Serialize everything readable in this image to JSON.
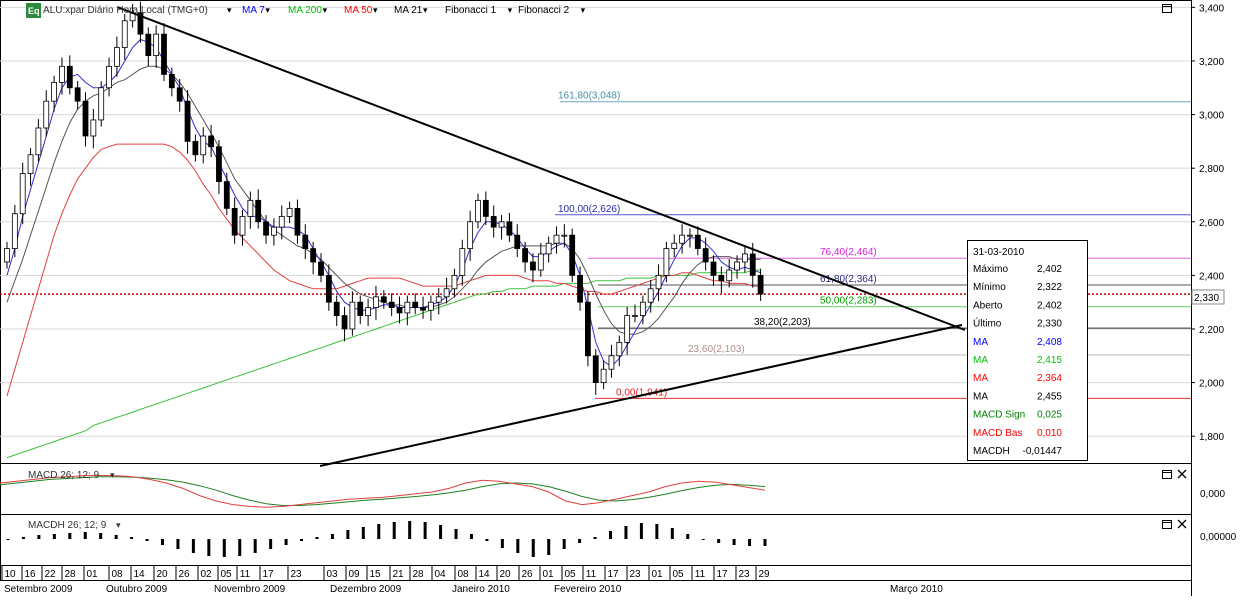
{
  "header": {
    "badge": "Eq",
    "symbol_label": "ALU:xpar Diário Hora Local (TMG+0)",
    "indicators": [
      {
        "label": "MA 7",
        "color": "#0000ff"
      },
      {
        "label": "MA 200",
        "color": "#00c000"
      },
      {
        "label": "MA 50",
        "color": "#ff0000"
      },
      {
        "label": "MA 21",
        "color": "#000000"
      },
      {
        "label": "Fibonacci 1",
        "color": "#000000"
      },
      {
        "label": "Fibonacci 2",
        "color": "#000000"
      }
    ],
    "dropdown_glyph": "▾"
  },
  "price_axis": {
    "ticks": [
      "3,400",
      "3,200",
      "3,000",
      "2,800",
      "2,600",
      "2,400",
      "2,200",
      "2,000",
      "1,800"
    ],
    "current_price": "2,330"
  },
  "macd_panel": {
    "label": "MACD 26; 12; 9",
    "axis_tick": "0,000"
  },
  "macdh_panel": {
    "label": "MACDH 26; 12; 9",
    "axis_tick": "0,00000"
  },
  "date_axis": {
    "days": [
      "10",
      "16",
      "22",
      "28",
      "01",
      "08",
      "14",
      "20",
      "26",
      "02",
      "05",
      "11",
      "17",
      "23",
      "03",
      "09",
      "15",
      "21",
      "28",
      "04",
      "08",
      "14",
      "20",
      "26",
      "01",
      "05",
      "11",
      "17",
      "23",
      "01",
      "05",
      "11",
      "17",
      "23",
      "29"
    ],
    "months": [
      "Setembro 2009",
      "Outubro 2009",
      "Novembro 2009",
      "Dezembro 2009",
      "Janeiro 2010",
      "Fevereiro 2010",
      "Março 2010"
    ]
  },
  "fib_labels": [
    {
      "text": "161,80(3,048)",
      "color": "#4a8fa8"
    },
    {
      "text": "100,00(2,626)",
      "color": "#2a2ab0"
    },
    {
      "text": "76,40(2,464)",
      "color": "#e020e0"
    },
    {
      "text": "61,80(2,364)",
      "color": "#2a2a80"
    },
    {
      "text": "50,00(2,283)",
      "color": "#00a000"
    },
    {
      "text": "38,20(2,203)",
      "color": "#000000"
    },
    {
      "text": "23,60(2,103)",
      "color": "#b09090"
    },
    {
      "text": "0,00(1,941)",
      "color": "#e02020"
    }
  ],
  "info_box": {
    "date": "31-03-2010",
    "rows": [
      {
        "label": "Máximo",
        "value": "2,402",
        "color": "#000000"
      },
      {
        "label": "Mínimo",
        "value": "2,322",
        "color": "#000000"
      },
      {
        "label": "Aberto",
        "value": "2,402",
        "color": "#000000"
      },
      {
        "label": "Último",
        "value": "2,330",
        "color": "#000000"
      },
      {
        "label": "MA",
        "value": "2,408",
        "color": "#0000ff"
      },
      {
        "label": "MA",
        "value": "2,415",
        "color": "#00c000"
      },
      {
        "label": "MA",
        "value": "2,364",
        "color": "#ff0000"
      },
      {
        "label": "MA",
        "value": "2,455",
        "color": "#000000"
      },
      {
        "label": "MACD Sign",
        "value": "0,025",
        "color": "#008000"
      },
      {
        "label": "MACD Bas",
        "value": "0,010",
        "color": "#ff0000"
      },
      {
        "label": "MACDH",
        "value": "-0,01447",
        "color": "#000000"
      }
    ]
  },
  "icons": {
    "maximize": "maximize-icon",
    "close": "close-icon"
  },
  "chart_data": {
    "type": "candlestick",
    "ylim": [
      1.7,
      3.42
    ],
    "closes": [
      2.5,
      2.63,
      2.78,
      2.85,
      2.95,
      3.05,
      3.12,
      3.18,
      3.1,
      3.05,
      2.92,
      2.98,
      3.1,
      3.18,
      3.25,
      3.35,
      3.38,
      3.3,
      3.22,
      3.3,
      3.15,
      3.1,
      3.05,
      2.9,
      2.85,
      2.92,
      2.88,
      2.75,
      2.65,
      2.55,
      2.62,
      2.68,
      2.6,
      2.55,
      2.58,
      2.62,
      2.65,
      2.55,
      2.5,
      2.45,
      2.4,
      2.3,
      2.25,
      2.2,
      2.3,
      2.25,
      2.28,
      2.32,
      2.3,
      2.28,
      2.26,
      2.3,
      2.28,
      2.27,
      2.3,
      2.32,
      2.35,
      2.4,
      2.5,
      2.6,
      2.68,
      2.62,
      2.58,
      2.6,
      2.55,
      2.5,
      2.45,
      2.42,
      2.48,
      2.52,
      2.55,
      2.55,
      2.4,
      2.3,
      2.1,
      2.0,
      2.05,
      2.1,
      2.15,
      2.25,
      2.25,
      2.3,
      2.35,
      2.4,
      2.5,
      2.52,
      2.55,
      2.55,
      2.5,
      2.45,
      2.4,
      2.38,
      2.42,
      2.45,
      2.48,
      2.4,
      2.33
    ],
    "ma7": [
      2.4,
      2.5,
      2.62,
      2.72,
      2.82,
      2.92,
      3.02,
      3.1,
      3.14,
      3.15,
      3.12,
      3.1,
      3.1,
      3.12,
      3.15,
      3.2,
      3.25,
      3.28,
      3.27,
      3.25,
      3.2,
      3.15,
      3.1,
      3.02,
      2.95,
      2.9,
      2.88,
      2.82,
      2.76,
      2.7,
      2.65,
      2.62,
      2.62,
      2.6,
      2.58,
      2.58,
      2.58,
      2.57,
      2.55,
      2.5,
      2.45,
      2.4,
      2.34,
      2.3,
      2.28,
      2.27,
      2.27,
      2.28,
      2.29,
      2.29,
      2.28,
      2.28,
      2.28,
      2.28,
      2.29,
      2.3,
      2.32,
      2.36,
      2.42,
      2.5,
      2.56,
      2.6,
      2.6,
      2.59,
      2.57,
      2.54,
      2.5,
      2.47,
      2.47,
      2.49,
      2.51,
      2.52,
      2.48,
      2.4,
      2.28,
      2.15,
      2.08,
      2.06,
      2.09,
      2.14,
      2.19,
      2.24,
      2.29,
      2.34,
      2.4,
      2.46,
      2.51,
      2.54,
      2.54,
      2.52,
      2.49,
      2.45,
      2.43,
      2.42,
      2.43,
      2.42,
      2.41
    ],
    "ma21": [
      2.3,
      2.38,
      2.46,
      2.55,
      2.64,
      2.73,
      2.82,
      2.9,
      2.97,
      3.02,
      3.05,
      3.07,
      3.08,
      3.1,
      3.12,
      3.13,
      3.15,
      3.17,
      3.18,
      3.18,
      3.17,
      3.15,
      3.12,
      3.08,
      3.03,
      2.98,
      2.93,
      2.88,
      2.82,
      2.76,
      2.72,
      2.68,
      2.64,
      2.6,
      2.57,
      2.55,
      2.53,
      2.51,
      2.5,
      2.48,
      2.46,
      2.43,
      2.4,
      2.37,
      2.35,
      2.33,
      2.32,
      2.31,
      2.3,
      2.29,
      2.29,
      2.28,
      2.28,
      2.28,
      2.28,
      2.29,
      2.3,
      2.32,
      2.35,
      2.38,
      2.42,
      2.45,
      2.47,
      2.49,
      2.5,
      2.51,
      2.51,
      2.51,
      2.51,
      2.51,
      2.52,
      2.52,
      2.5,
      2.46,
      2.4,
      2.33,
      2.27,
      2.22,
      2.19,
      2.18,
      2.18,
      2.19,
      2.21,
      2.24,
      2.28,
      2.32,
      2.37,
      2.41,
      2.44,
      2.46,
      2.47,
      2.47,
      2.47,
      2.46,
      2.46,
      2.46,
      2.46
    ],
    "ma50": [
      1.95,
      2.05,
      2.15,
      2.25,
      2.35,
      2.45,
      2.55,
      2.63,
      2.7,
      2.76,
      2.8,
      2.84,
      2.87,
      2.88,
      2.89,
      2.89,
      2.89,
      2.89,
      2.89,
      2.89,
      2.89,
      2.88,
      2.86,
      2.83,
      2.79,
      2.74,
      2.7,
      2.65,
      2.61,
      2.57,
      2.54,
      2.51,
      2.48,
      2.45,
      2.42,
      2.4,
      2.38,
      2.37,
      2.36,
      2.35,
      2.35,
      2.35,
      2.35,
      2.36,
      2.37,
      2.38,
      2.39,
      2.39,
      2.39,
      2.39,
      2.39,
      2.38,
      2.37,
      2.36,
      2.36,
      2.36,
      2.36,
      2.36,
      2.37,
      2.38,
      2.39,
      2.4,
      2.4,
      2.4,
      2.4,
      2.4,
      2.39,
      2.38,
      2.38,
      2.38,
      2.37,
      2.37,
      2.36,
      2.35,
      2.34,
      2.34,
      2.33,
      2.33,
      2.34,
      2.35,
      2.36,
      2.37,
      2.38,
      2.39,
      2.4,
      2.4,
      2.41,
      2.41,
      2.4,
      2.39,
      2.38,
      2.38,
      2.37,
      2.37,
      2.37,
      2.36,
      2.36
    ],
    "ma200": [
      1.72,
      1.73,
      1.74,
      1.75,
      1.76,
      1.77,
      1.78,
      1.79,
      1.8,
      1.81,
      1.82,
      1.84,
      1.85,
      1.86,
      1.87,
      1.88,
      1.89,
      1.9,
      1.91,
      1.92,
      1.93,
      1.94,
      1.95,
      1.96,
      1.97,
      1.98,
      1.99,
      2.0,
      2.01,
      2.02,
      2.03,
      2.04,
      2.05,
      2.06,
      2.07,
      2.08,
      2.09,
      2.1,
      2.11,
      2.12,
      2.13,
      2.14,
      2.15,
      2.16,
      2.17,
      2.18,
      2.19,
      2.2,
      2.21,
      2.22,
      2.23,
      2.24,
      2.25,
      2.26,
      2.27,
      2.28,
      2.29,
      2.3,
      2.31,
      2.32,
      2.33,
      2.33,
      2.34,
      2.34,
      2.35,
      2.35,
      2.35,
      2.36,
      2.36,
      2.36,
      2.36,
      2.37,
      2.37,
      2.37,
      2.37,
      2.38,
      2.38,
      2.38,
      2.38,
      2.39,
      2.39,
      2.39,
      2.39,
      2.4,
      2.4,
      2.4,
      2.4,
      2.4,
      2.41,
      2.41,
      2.41,
      2.41,
      2.41,
      2.41,
      2.41,
      2.42,
      2.42
    ],
    "fib_levels": [
      3.048,
      2.626,
      2.464,
      2.364,
      2.283,
      2.203,
      2.103,
      1.941
    ],
    "current_level": 2.33,
    "trendline_upper": [
      [
        0.6,
        3.4
      ],
      [
        25,
        2.25
      ]
    ],
    "trendline_lower": [
      [
        0,
        1.28
      ],
      [
        24,
        2.22
      ]
    ],
    "macd": [
      0.05,
      0.06,
      0.07,
      0.08,
      0.085,
      0.09,
      0.092,
      0.09,
      0.085,
      0.07,
      0.05,
      0.02,
      -0.02,
      -0.05,
      -0.07,
      -0.08,
      -0.085,
      -0.08,
      -0.07,
      -0.06,
      -0.05,
      -0.04,
      -0.035,
      -0.03,
      -0.02,
      -0.01,
      0.0,
      0.02,
      0.05,
      0.065,
      0.06,
      0.045,
      0.03,
      0.0,
      -0.05,
      -0.07,
      -0.06,
      -0.04,
      -0.02,
      0.0,
      0.03,
      0.05,
      0.06,
      0.055,
      0.04,
      0.025,
      0.01
    ],
    "macd_signal": [
      0.04,
      0.05,
      0.06,
      0.07,
      0.075,
      0.08,
      0.085,
      0.085,
      0.083,
      0.077,
      0.068,
      0.055,
      0.035,
      0.01,
      -0.02,
      -0.045,
      -0.065,
      -0.075,
      -0.075,
      -0.07,
      -0.062,
      -0.054,
      -0.046,
      -0.04,
      -0.033,
      -0.025,
      -0.016,
      -0.005,
      0.01,
      0.03,
      0.045,
      0.05,
      0.045,
      0.03,
      0.005,
      -0.025,
      -0.045,
      -0.05,
      -0.042,
      -0.03,
      -0.012,
      0.008,
      0.025,
      0.038,
      0.042,
      0.038,
      0.03
    ],
    "macdh": [
      0.0,
      0.004,
      0.008,
      0.01,
      0.012,
      0.014,
      0.012,
      0.008,
      0.004,
      -0.004,
      -0.012,
      -0.02,
      -0.028,
      -0.034,
      -0.036,
      -0.034,
      -0.028,
      -0.02,
      -0.012,
      -0.004,
      0.004,
      0.01,
      0.018,
      0.024,
      0.03,
      0.034,
      0.036,
      0.034,
      0.028,
      0.02,
      0.01,
      -0.004,
      -0.018,
      -0.028,
      -0.036,
      -0.032,
      -0.02,
      -0.008,
      0.004,
      0.016,
      0.026,
      0.032,
      0.03,
      0.022,
      0.01,
      0.0,
      -0.008,
      -0.012,
      -0.014,
      -0.014
    ]
  }
}
